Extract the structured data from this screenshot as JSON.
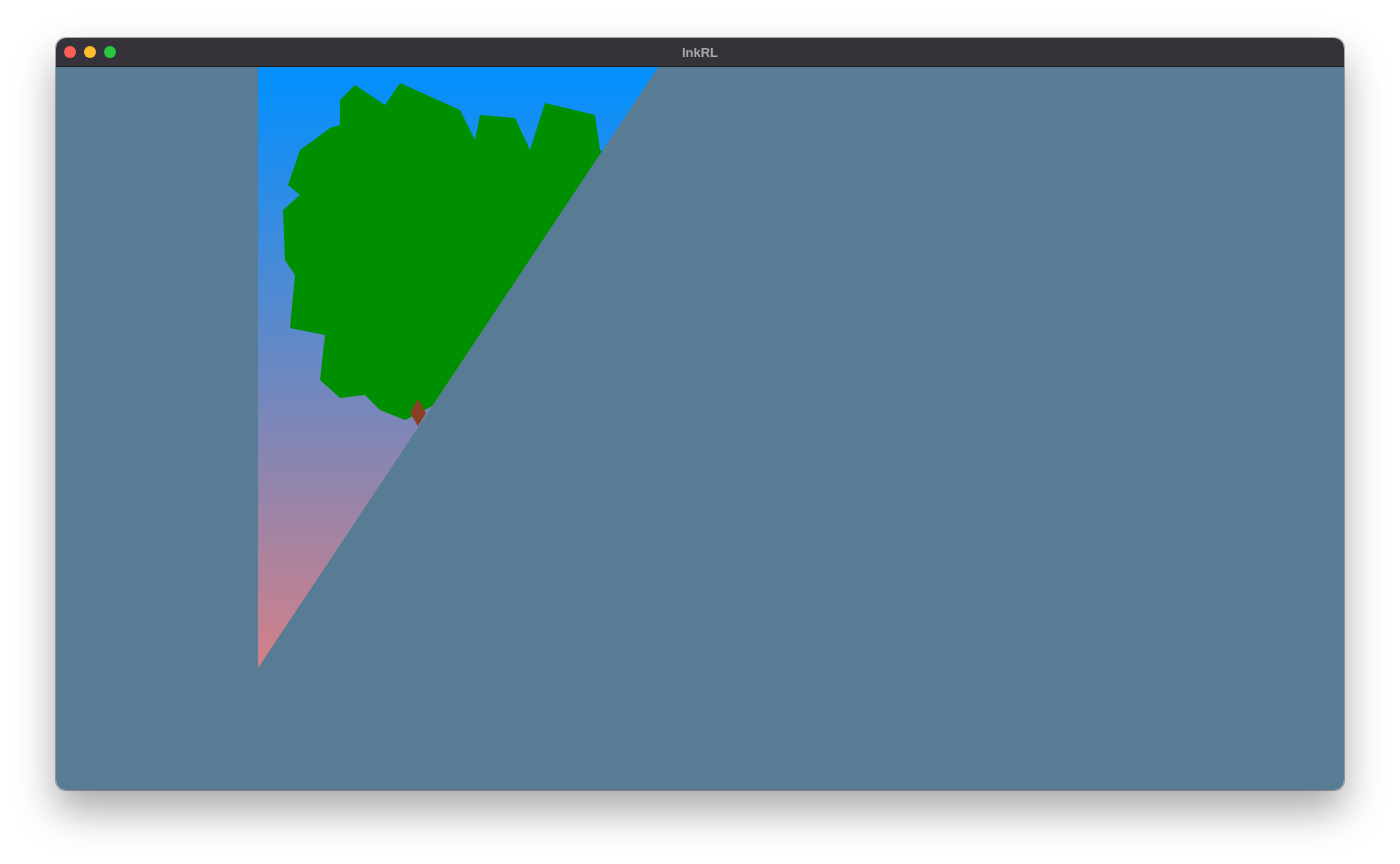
{
  "window": {
    "title": "InkRL"
  }
}
